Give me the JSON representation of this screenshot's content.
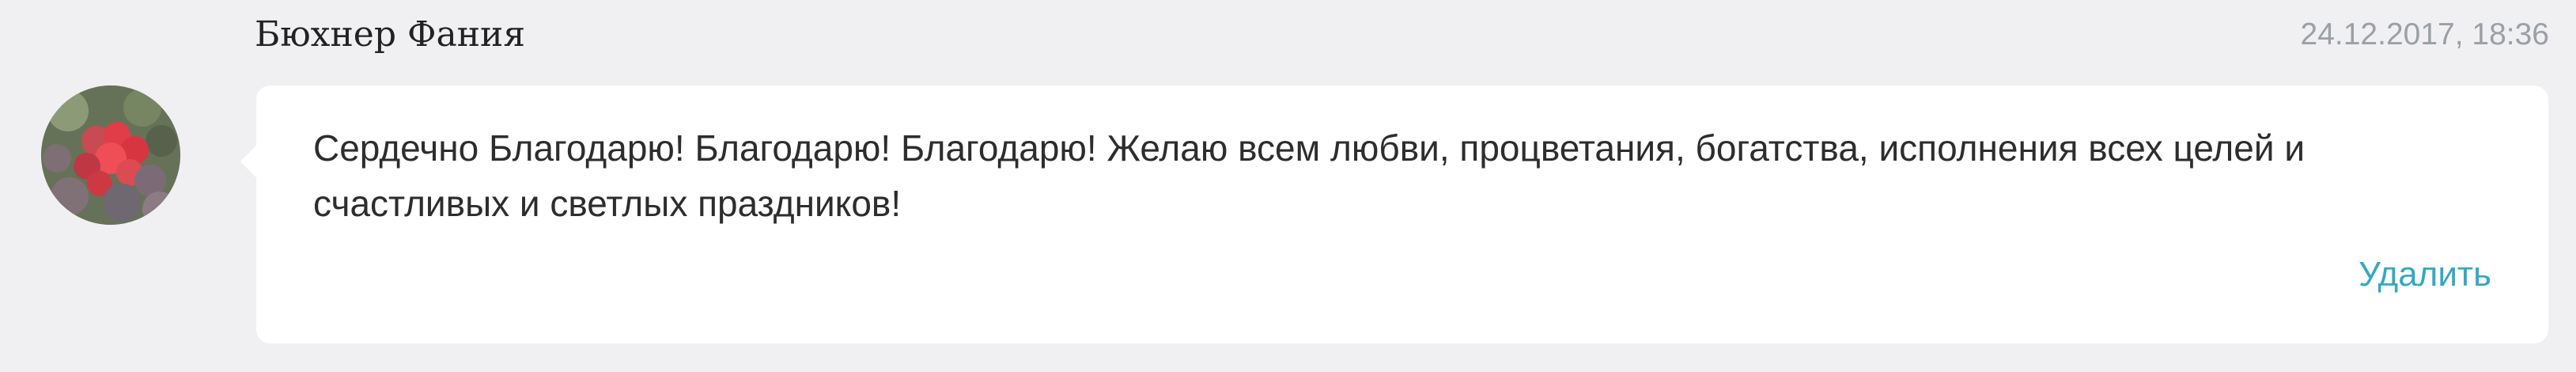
{
  "comment": {
    "author": "Бюхнер Фания",
    "timestamp": "24.12.2017, 18:36",
    "avatar_icon": "avatar-flowers-icon",
    "message": "Сердечно Благодарю! Благодарю! Благодарю! Желаю всем  любви, процветания, богатства, исполнения всех целей и счастливых и светлых праздников!",
    "delete_label": "Удалить"
  },
  "colors": {
    "page_background": "#f0f0f3",
    "bubble_background": "#ffffff",
    "author_text": "#222222",
    "timestamp_text": "#9aa0a6",
    "message_text": "#2d2d2d",
    "link_accent": "#34a8c4"
  }
}
